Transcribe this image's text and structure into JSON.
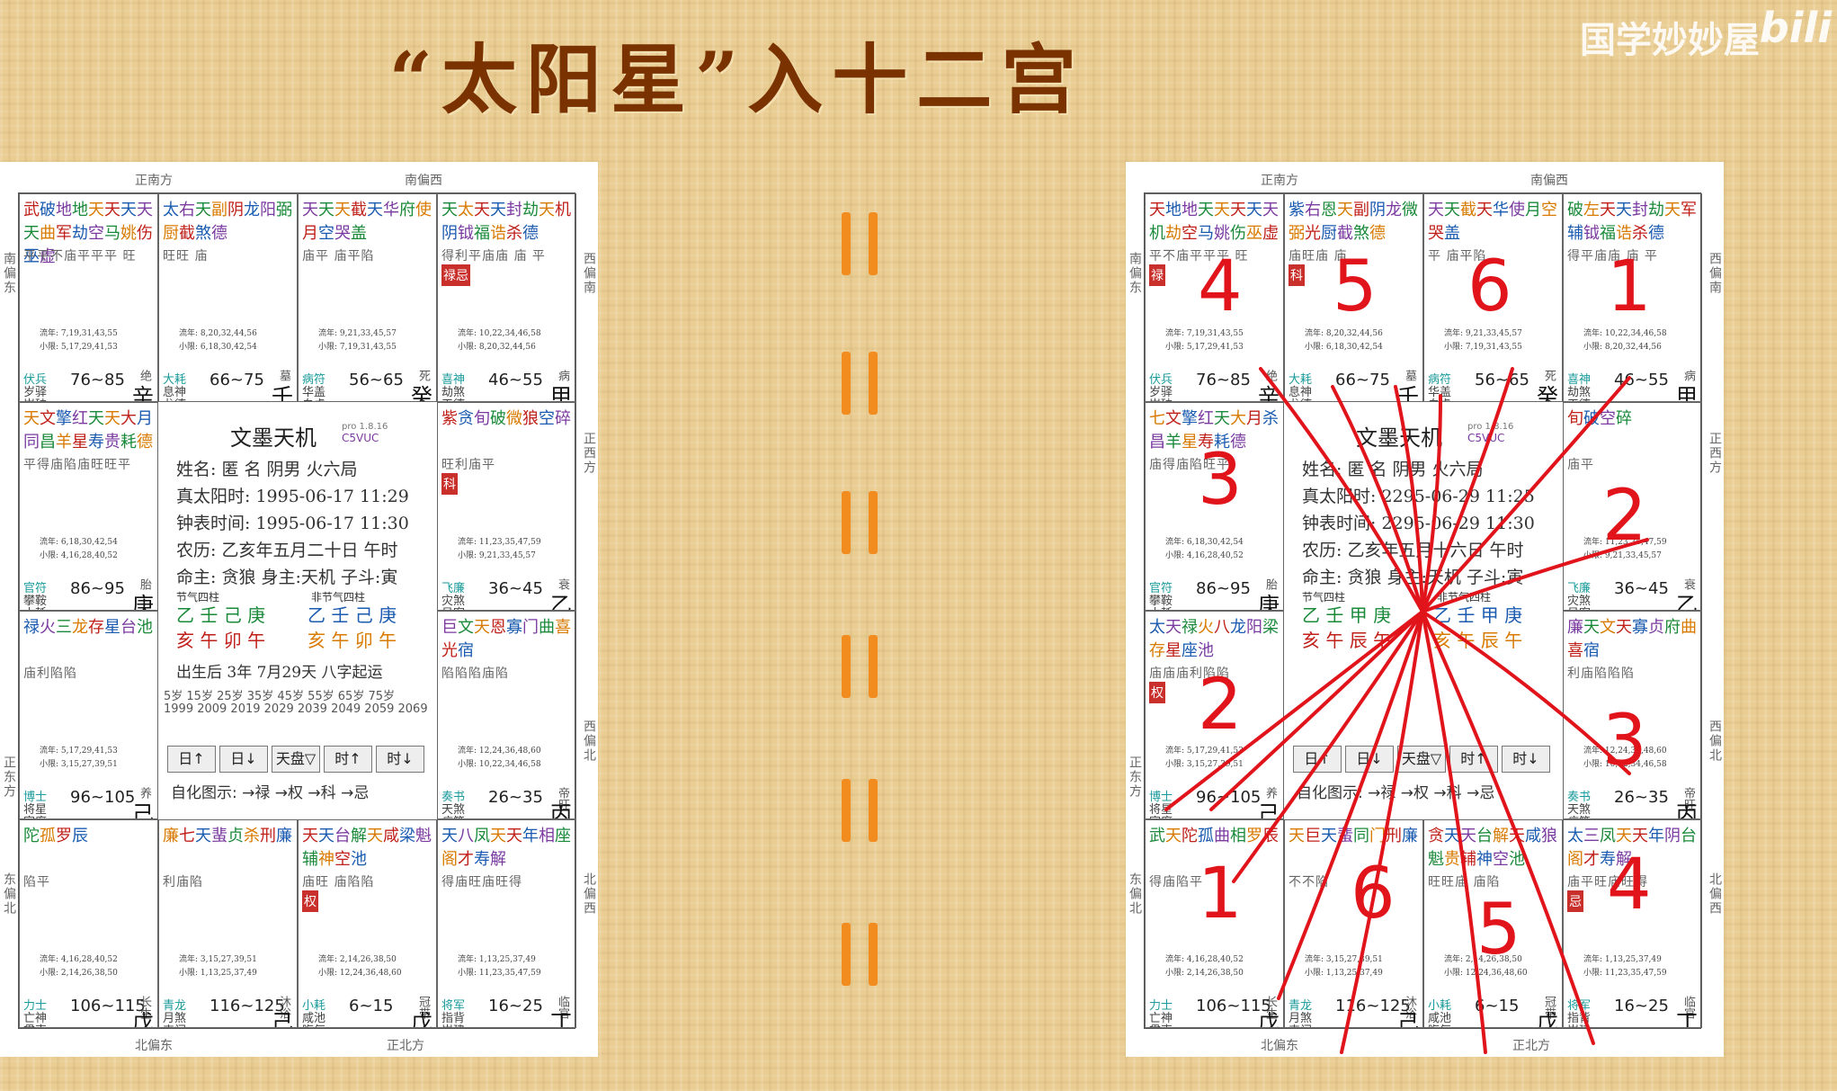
{
  "title": "“太阳星”入十二宫",
  "watermark": "国学妙妙屋",
  "bili": "bili",
  "divider_symbol": "=",
  "left": {
    "directions": {
      "top_left": "正南方",
      "top_right": "南偏西",
      "bottom_left": "北偏东",
      "bottom_right": "正北方",
      "left_upper": "南偏东",
      "left_lower": "正东方",
      "left_bottom": "东偏北",
      "right_upper": "西偏南",
      "right_middle": "正西方",
      "right_lower": "西偏北",
      "right_bottom": "北偏西"
    },
    "cells": [
      {
        "pos": "si",
        "stars": "武破地地天天天天天曲军劫空马姚伤巫虚",
        "bright": "平平不庙平平平 旺",
        "sihua": "",
        "liu": "流年: 7,19,31,43,55\n小限: 5,17,29,41,53",
        "god": [
          "伏兵",
          "岁驿",
          "岁破"
        ],
        "age": "76~85",
        "cs": "绝",
        "gz": "辛巳",
        "palace": "交友"
      },
      {
        "pos": "wu",
        "stars": "太右天副阴龙阳弼厨截煞德",
        "bright": "旺旺 庙",
        "sihua": "",
        "liu": "流年: 8,20,32,44,56\n小限: 6,18,30,42,54",
        "god": [
          "大耗",
          "息神",
          "龙德"
        ],
        "age": "66~75",
        "cs": "墓",
        "gz": "壬午",
        "palace": "迁移"
      },
      {
        "pos": "wei",
        "stars": "天天天截天华府使月空哭盖",
        "bright": "庙平 庙平陷",
        "sihua": "",
        "liu": "流年: 9,21,33,45,57\n小限: 7,19,31,43,55",
        "god": [
          "病符",
          "华盖",
          "白虎"
        ],
        "age": "56~65",
        "cs": "死",
        "gz": "癸未",
        "palace": "疾厄"
      },
      {
        "pos": "shen",
        "stars": "天太天天封劫天机阴钺福诰杀德",
        "bright": "得利平庙庙 庙 平",
        "sihua": "禄忌",
        "liu": "流年: 10,22,34,46,58\n小限: 8,20,32,44,56",
        "god": [
          "喜神",
          "劫煞",
          "天德"
        ],
        "age": "46~55",
        "cs": "病",
        "gz": "甲申",
        "palace": "财帛"
      },
      {
        "pos": "chen",
        "stars": "天文擎红天天大月同昌羊星寿贵耗德",
        "bright": "平得庙陷庙旺旺平",
        "sihua": "",
        "liu": "流年: 6,18,30,42,54\n小限: 4,16,28,40,52",
        "god": [
          "官符",
          "攀鞍",
          "小耗"
        ],
        "age": "86~95",
        "cs": "胎",
        "gz": "庚辰",
        "palace": "官禄"
      },
      {
        "pos": "you",
        "stars": "紫贪旬破微狼空碎",
        "bright": "旺利庙平",
        "sihua": "科",
        "liu": "流年: 11,23,35,47,59\n小限: 9,21,33,45,57",
        "god": [
          "飞廉",
          "灾煞",
          "吊客"
        ],
        "age": "36~45",
        "cs": "衰",
        "gz": "乙酉",
        "palace": "子女"
      },
      {
        "pos": "mao",
        "stars": "禄火三龙存星台池",
        "bright": "庙利陷陷",
        "sihua": "",
        "liu": "流年: 5,17,29,41,53\n小限: 3,15,27,39,51",
        "god": [
          "博士",
          "将星",
          "官府"
        ],
        "age": "96~105",
        "cs": "养",
        "gz": "己卯",
        "palace": "田宅"
      },
      {
        "pos": "xu",
        "stars": "巨文天恩寡门曲喜光宿",
        "bright": "陷陷陷庙陷",
        "sihua": "",
        "liu": "流年: 12,24,36,48,60\n小限: 10,22,34,46,58",
        "god": [
          "奏书",
          "天煞",
          "病符"
        ],
        "age": "26~35",
        "cs": "帝旺",
        "gz": "丙戌",
        "palace": "夫妻"
      },
      {
        "pos": "yin",
        "stars": "陀孤罗辰",
        "bright": "陷平",
        "sihua": "",
        "liu": "流年: 4,16,28,40,52\n小限: 2,14,26,38,50",
        "god": [
          "力士",
          "亡神",
          "贯索"
        ],
        "age": "106~115",
        "cs": "长生",
        "gz": "戊寅",
        "palace": "福德"
      },
      {
        "pos": "chou",
        "stars": "廉七天蜚贞杀刑廉",
        "bright": "利庙陷",
        "sihua": "",
        "liu": "流年: 3,15,27,39,51\n小限: 1,13,25,37,49",
        "god": [
          "青龙",
          "月煞",
          "丧门"
        ],
        "age": "116~125",
        "cs": "沐浴",
        "gz": "己丑",
        "palace": "父母"
      },
      {
        "pos": "zi",
        "stars": "天天台解天咸梁魁辅神空池",
        "bright": "庙旺 庙陷陷",
        "sihua": "权",
        "liu": "流年: 2,14,26,38,50\n小限: 12,24,36,48,60",
        "god": [
          "小耗",
          "咸池",
          "晦气"
        ],
        "age": "6~15",
        "cs": "冠带",
        "gz": "戊子",
        "palace": "命宫"
      },
      {
        "pos": "hai",
        "stars": "天八凤天天年相座阁才寿解",
        "bright": "得庙旺庙旺得",
        "sihua": "",
        "liu": "流年: 1,13,25,37,49\n小限: 11,23,35,47,59",
        "god": [
          "将军",
          "指背",
          "岁建"
        ],
        "age": "16~25",
        "cs": "临官",
        "gz": "丁亥",
        "palace": "兄弟"
      }
    ],
    "center": {
      "app": "文墨天机",
      "ver": "pro 1.8.16",
      "code": "C5VUC",
      "lines": [
        "姓名: 匿 名      阴男 火六局",
        "真太阳时: 1995-06-17 11:29",
        "钟表时间: 1995-06-17 11:30",
        "农历: 乙亥年五月二十日 午时",
        "命主: 贪狼 身主:天机 子斗:寅"
      ],
      "p1": "节气四柱",
      "p2": "非节气四柱",
      "gan1": "乙 壬 己 庚",
      "zhi1": "亥 午 卯 午",
      "gan2": "乙 壬 己 庚",
      "zhi2": "亥 午 卯 午",
      "qiyun": "出生后 3年 7月29天 八字起运",
      "dayun": "5岁 15岁 25岁 35岁 45岁 55岁 65岁 75岁",
      "dayun_years": "1999 2009 2019 2029 2039 2049 2059 2069",
      "buttons": [
        "日↑",
        "日↓",
        "天盘▽",
        "时↑",
        "时↓"
      ],
      "zihua": "自化图示: →禄 →权 →科 →忌"
    }
  },
  "right": {
    "directions": {
      "top_left": "正南方",
      "top_right": "南偏西",
      "bottom_left": "北偏东",
      "bottom_right": "正北方",
      "left_upper": "南偏东",
      "left_lower": "正东方",
      "left_bottom": "东偏北",
      "right_upper": "西偏南",
      "right_middle": "正西方",
      "right_lower": "西偏北",
      "right_bottom": "北偏西"
    },
    "cells": [
      {
        "pos": "si",
        "stars": "天地地天天天天天机劫空马姚伤巫虚",
        "bright": "平不庙平平平 旺",
        "sihua": "禄",
        "liu": "流年: 7,19,31,43,55\n小限: 5,17,29,41,53",
        "god": [
          "伏兵",
          "岁驿",
          "岁破"
        ],
        "age": "76~85",
        "cs": "绝",
        "gz": "辛巳",
        "palace": "交友"
      },
      {
        "pos": "wu",
        "stars": "紫右恩天副阴龙微弼光厨截煞德",
        "bright": "庙旺庙 庙",
        "sihua": "科",
        "liu": "流年: 8,20,32,44,56\n小限: 6,18,30,42,54",
        "god": [
          "大耗",
          "息神",
          "龙德"
        ],
        "age": "66~75",
        "cs": "墓",
        "gz": "壬午",
        "palace": "迁移"
      },
      {
        "pos": "wei",
        "stars": "天天截天华使月空哭盖",
        "bright": "平 庙平陷",
        "sihua": "",
        "liu": "流年: 9,21,33,45,57\n小限: 7,19,31,43,55",
        "god": [
          "病符",
          "华盖",
          "白虎"
        ],
        "age": "56~65",
        "cs": "死",
        "gz": "癸未",
        "palace": "疾厄"
      },
      {
        "pos": "shen",
        "stars": "破左天天封劫天军辅钺福诰杀德",
        "bright": "得平庙庙 庙 平",
        "sihua": "",
        "liu": "流年: 10,22,34,46,58\n小限: 8,20,32,44,56",
        "god": [
          "喜神",
          "劫煞",
          "天德"
        ],
        "age": "46~55",
        "cs": "病",
        "gz": "甲申",
        "palace": "财帛"
      },
      {
        "pos": "chen",
        "stars": "七文擎红天大月杀昌羊星寿耗德",
        "bright": "庙得庙陷旺平",
        "sihua": "",
        "liu": "流年: 6,18,30,42,54\n小限: 4,16,28,40,52",
        "god": [
          "官符",
          "攀鞍",
          "小耗"
        ],
        "age": "86~95",
        "cs": "胎",
        "gz": "庚辰",
        "palace": "官禄"
      },
      {
        "pos": "you",
        "stars": "旬破空碎",
        "bright": "庙平",
        "sihua": "",
        "liu": "流年: 11,23,35,47,59\n小限: 9,21,33,45,57",
        "god": [
          "飞廉",
          "灾煞",
          "吊客"
        ],
        "age": "36~45",
        "cs": "衰",
        "gz": "乙酉",
        "palace": "子女"
      },
      {
        "pos": "mao",
        "stars": "太天禄火八龙阳梁存星座池",
        "bright": "庙庙庙利陷陷",
        "sihua": "权",
        "liu": "流年: 5,17,29,41,53\n小限: 3,15,27,39,51",
        "god": [
          "博士",
          "将星",
          "官府"
        ],
        "age": "96~105",
        "cs": "养",
        "gz": "己卯",
        "palace": "田宅"
      },
      {
        "pos": "xu",
        "stars": "廉天文天寡贞府曲喜宿",
        "bright": "利庙陷陷陷",
        "sihua": "",
        "liu": "流年: 12,24,36,48,60\n小限: 10,22,34,46,58",
        "god": [
          "奏书",
          "天煞",
          "病符"
        ],
        "age": "26~35",
        "cs": "帝旺",
        "gz": "丙戌",
        "palace": "夫妻"
      },
      {
        "pos": "yin",
        "stars": "武天陀孤曲相罗辰",
        "bright": "得庙陷平",
        "sihua": "",
        "liu": "流年: 4,16,28,40,52\n小限: 2,14,26,38,50",
        "god": [
          "力士",
          "亡神",
          "贯索"
        ],
        "age": "106~115",
        "cs": "长生",
        "gz": "戊寅",
        "palace": "福德"
      },
      {
        "pos": "chou",
        "stars": "天巨天蜚同门刑廉",
        "bright": "不不陷",
        "sihua": "",
        "liu": "流年: 3,15,27,39,51\n小限: 1,13,25,37,49",
        "god": [
          "青龙",
          "月煞",
          "丧门"
        ],
        "age": "116~125",
        "cs": "沐浴",
        "gz": "己丑",
        "palace": "父母"
      },
      {
        "pos": "zi",
        "stars": "贪天天台解天咸狼魁贵辅神空池",
        "bright": "旺旺庙 庙陷",
        "sihua": "",
        "liu": "流年: 2,14,26,38,50\n小限: 12,24,36,48,60",
        "god": [
          "小耗",
          "咸池",
          "晦气"
        ],
        "age": "6~15",
        "cs": "冠带",
        "gz": "戊子",
        "palace": "命宫"
      },
      {
        "pos": "hai",
        "stars": "太三凤天天年阴台阁才寿解",
        "bright": "庙平旺庙旺得",
        "sihua": "忌",
        "liu": "流年: 1,13,25,37,49\n小限: 11,23,35,47,59",
        "god": [
          "将军",
          "指背",
          "岁建"
        ],
        "age": "16~25",
        "cs": "临官",
        "gz": "丁亥",
        "palace": "兄弟"
      }
    ],
    "center": {
      "app": "文墨天机",
      "ver": "pro 1.8.16",
      "code": "C5VUC",
      "lines": [
        "姓名: 匿 名      阴男 火六局",
        "真太阳时: 2295-06-29 11:25",
        "钟表时间: 2295-06-29 11:30",
        "农历: 乙亥年五月十六日 午时",
        "命主: 贪狼 身主:天机 子斗:寅"
      ],
      "p1": "节气四柱",
      "p2": "非节气四柱",
      "gan1": "乙 壬 甲 庚",
      "zhi1": "亥 午 辰 午",
      "gan2": "乙 壬 甲 庚",
      "zhi2": "亥 午 辰 午",
      "qiyun": "",
      "dayun": "",
      "dayun_years": "",
      "buttons": [
        "日↑",
        "日↓",
        "天盘▽",
        "时↑",
        "时↓"
      ],
      "zihua": "自化图示: →禄 →权 →科 →忌"
    },
    "ink_numbers": [
      "4",
      "5",
      "6",
      "1",
      "3",
      "2",
      "2",
      "3",
      "1",
      "6",
      "5",
      "4"
    ]
  }
}
